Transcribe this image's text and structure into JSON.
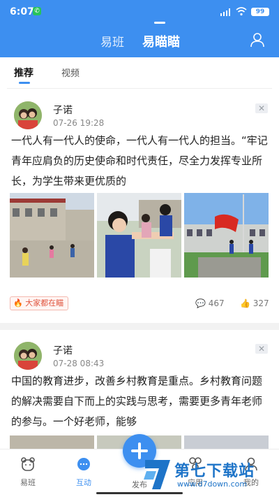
{
  "status_bar": {
    "time": "6:07",
    "battery": "99"
  },
  "top_tabs": [
    {
      "label": "易班"
    },
    {
      "label": "易瞄瞄"
    }
  ],
  "sub_tabs": [
    {
      "label": "推荐"
    },
    {
      "label": "视频"
    }
  ],
  "posts": [
    {
      "author": "子诺",
      "time": "07-26 19:28",
      "text": "一代人有一代人的使命，一代人有一代人的担当。“牢记青年应肩负的历史使命和时代责任，尽全力发挥专业所长，为学生带来更优质的",
      "tag": "大家都在瞄",
      "comments": "467",
      "likes": "327"
    },
    {
      "author": "子诺",
      "time": "07-28 08:43",
      "text": "中国的教育进步，改善乡村教育是重点。乡村教育问题的解决需要自下而上的实践与思考，需要更多青年老师的参与。一个好老师，能够"
    }
  ],
  "bottom_nav": [
    {
      "label": "易班"
    },
    {
      "label": "互动"
    },
    {
      "label": "发布"
    },
    {
      "label": "应用"
    },
    {
      "label": "我的"
    }
  ],
  "watermark": {
    "title": "第七下载站",
    "url": "www.d7down.com"
  },
  "colors": {
    "primary": "#3d8ff0",
    "hot_tag": "#e0553f"
  }
}
